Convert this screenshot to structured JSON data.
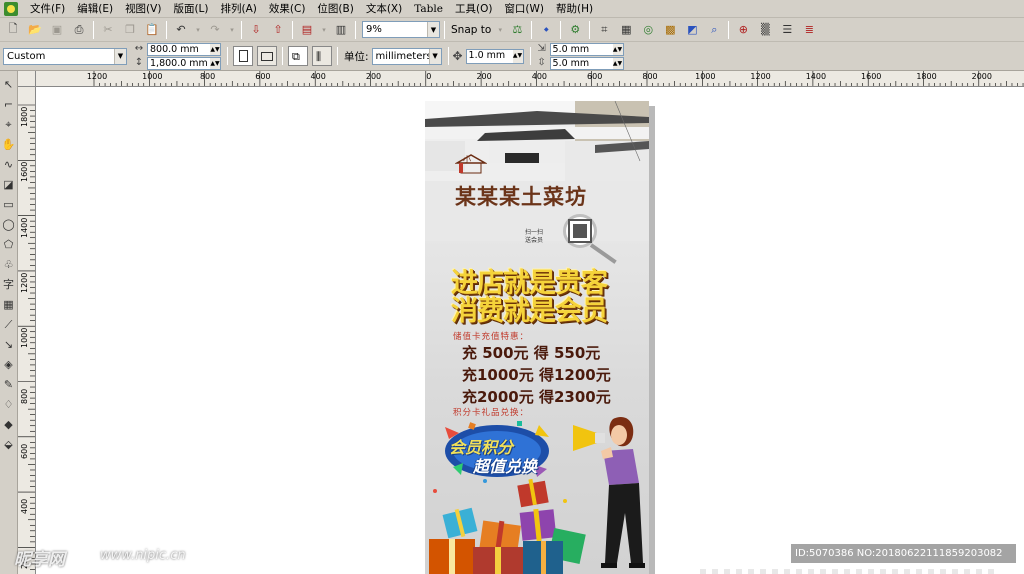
{
  "menu": {
    "items": [
      "文件(F)",
      "编辑(E)",
      "视图(V)",
      "版面(L)",
      "排列(A)",
      "效果(C)",
      "位图(B)",
      "文本(X)",
      "Table",
      "工具(O)",
      "窗口(W)",
      "帮助(H)"
    ]
  },
  "toolbar": {
    "zoom_value": "9%",
    "snap_label": "Snap to",
    "icons": [
      "new-icon",
      "open-icon",
      "save-icon",
      "print-icon",
      "cut-icon",
      "copy-icon",
      "paste-icon",
      "undo-icon",
      "redo-icon",
      "import-icon",
      "export-icon",
      "application-launcher-icon",
      "welcome-screen-icon"
    ]
  },
  "property_bar": {
    "paper_preset": "Custom",
    "width": "800.0 mm",
    "height": "1,800.0 mm",
    "units_label": "单位:",
    "units_value": "millimeters",
    "nudge": "1.0 mm",
    "dup_x": "5.0 mm",
    "dup_y": "5.0 mm"
  },
  "ruler": {
    "h_labels": [
      "1200",
      "1000",
      "800",
      "600",
      "400",
      "200",
      "0",
      "200",
      "400",
      "600",
      "800",
      "1000",
      "1200",
      "1400",
      "1600",
      "1800",
      "2000"
    ],
    "v_labels": [
      "1800",
      "1600",
      "1400",
      "1200",
      "1000",
      "800",
      "600",
      "400",
      "200"
    ],
    "unit": "millimeters"
  },
  "poster": {
    "logo_text": "小",
    "shop_name": "某某某土菜坊",
    "qr_note": "扫一扫 送会员",
    "slogan_line1": "进店就是贵客",
    "slogan_line2": "消费就是会员",
    "stored_value_heading": "储值卡充值特惠：",
    "offers": [
      "充 500元 得 550元",
      "充1000元 得1200元",
      "充2000元 得2300元"
    ],
    "points_heading": "积分卡礼品兑换：",
    "badge_line1": "会员积分",
    "badge_line2": "超值兑换"
  },
  "watermark": {
    "site_logo": "昵享网",
    "site_url": "www.nipic.cn",
    "image_id": "ID:5070386 NO:20180622111859203082"
  },
  "colors": {
    "chrome": "#d4d0c8",
    "shop_name": "#6b3419",
    "slogan_gold": "#f5d33a",
    "offer_text": "#4a1a0c",
    "sub_heading": "#c0392b"
  }
}
